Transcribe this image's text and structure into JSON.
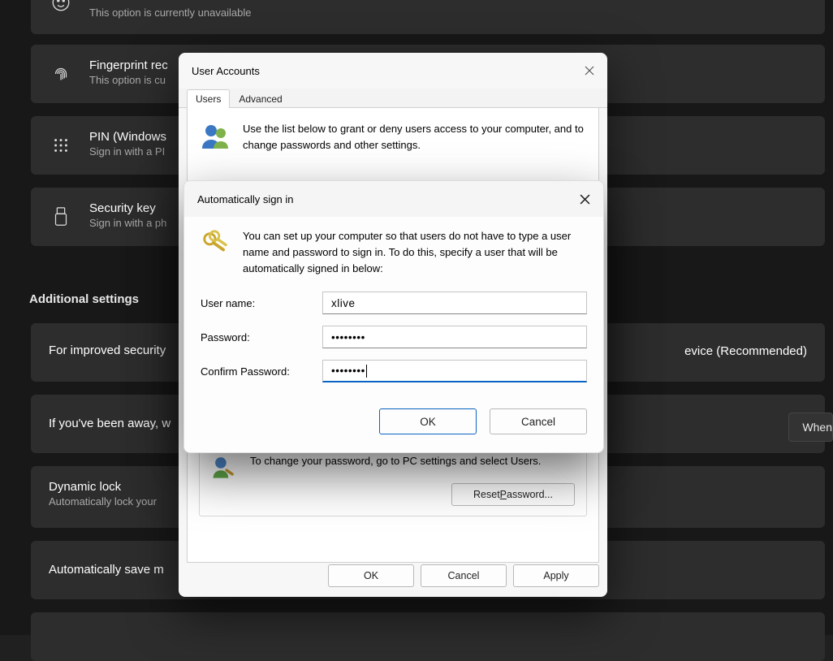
{
  "background": {
    "cards": [
      {
        "key": "facial",
        "title": "",
        "sub": "This option is currently unavailable"
      },
      {
        "key": "fingerprint",
        "title": "Fingerprint rec",
        "sub": "This option is cu"
      },
      {
        "key": "pin",
        "title": "PIN (Windows",
        "sub": "Sign in with a PI"
      },
      {
        "key": "security",
        "title": "Security key",
        "sub": "Sign in with a ph"
      }
    ],
    "section_heading": "Additional settings",
    "rows": [
      "For improved security",
      "If you've been away, w",
      "Dynamic lock",
      "Automatically save m"
    ],
    "dynamic_lock_sub": "Automatically lock your",
    "improved_security_suffix": "evice (Recommended)",
    "when_button": "When"
  },
  "user_accounts": {
    "title": "User Accounts",
    "tabs": {
      "users": "Users",
      "advanced": "Advanced",
      "active": "users"
    },
    "intro": "Use the list below to grant or deny users access to your computer, and to change passwords and other settings.",
    "password_panel": {
      "text": "To change your password, go to PC settings and select Users.",
      "reset_label_pre": "Reset ",
      "reset_label_u": "P",
      "reset_label_post": "assword..."
    },
    "buttons": {
      "ok": "OK",
      "cancel": "Cancel",
      "apply": "Apply"
    }
  },
  "auto_signin": {
    "title": "Automatically sign in",
    "intro": "You can set up your computer so that users do not have to type a user name and password to sign in. To do this, specify a user that will be automatically signed in below:",
    "labels": {
      "username": "User name:",
      "password": "Password:",
      "confirm": "Confirm Password:"
    },
    "values": {
      "username": "xlive",
      "password_dots": "••••••••",
      "confirm_dots": "••••••••"
    },
    "buttons": {
      "ok": "OK",
      "cancel": "Cancel"
    }
  }
}
